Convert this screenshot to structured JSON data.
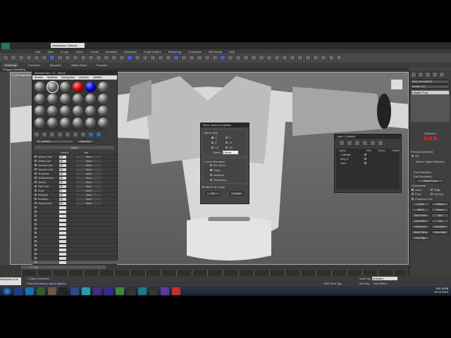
{
  "window": {
    "title": "Workspace: Default"
  },
  "menu": [
    "Edit",
    "Tools",
    "Group",
    "Views",
    "Create",
    "Modifiers",
    "Animation",
    "Graph Editors",
    "Rendering",
    "Customize",
    "MAXScript",
    "Help"
  ],
  "ribbon": {
    "tabs": [
      "Modeling",
      "Freeform",
      "Selection",
      "Object Paint",
      "Populate"
    ],
    "panel": "Polygon Modeling"
  },
  "viewport": {
    "label": "[+] [Perspective] [Shaded]"
  },
  "material_editor": {
    "title": "Material Editor - 01 - Default",
    "menu": [
      "Modes",
      "Material",
      "Navigation",
      "Options",
      "Utilities"
    ],
    "material_name": "01 - Default",
    "material_type": "Standard",
    "maps_title": "Maps",
    "headers": [
      "Amount",
      "Map"
    ],
    "rows": [
      {
        "name": "Ambient Color",
        "amount": "100",
        "map": "None"
      },
      {
        "name": "Diffuse Color",
        "amount": "100",
        "map": "None"
      },
      {
        "name": "Specular Color",
        "amount": "100",
        "map": "None"
      },
      {
        "name": "Specular Level",
        "amount": "100",
        "map": "None"
      },
      {
        "name": "Glossiness",
        "amount": "100",
        "map": "None"
      },
      {
        "name": "Self-Illumination",
        "amount": "100",
        "map": "None"
      },
      {
        "name": "Opacity",
        "amount": "100",
        "map": "None"
      },
      {
        "name": "Filter Color",
        "amount": "100",
        "map": "None"
      },
      {
        "name": "Bump",
        "amount": "30",
        "map": "None"
      },
      {
        "name": "Reflection",
        "amount": "100",
        "map": "None"
      },
      {
        "name": "Refraction",
        "amount": "100",
        "map": "None"
      },
      {
        "name": "Displacement",
        "amount": "100",
        "map": "None"
      }
    ]
  },
  "mirror_dialog": {
    "title": "Mirror: World Coordinates",
    "axis_title": "Mirror Axis:",
    "axes": [
      "X",
      "Y",
      "Z",
      "XY",
      "YZ",
      "ZX"
    ],
    "offset_label": "Offset:",
    "offset_value": "0.0mm",
    "clone_title": "Clone Selection:",
    "clone_options": [
      "No Clone",
      "Copy",
      "Instance",
      "Reference"
    ],
    "selected_clone": "Copy",
    "ik_label": "Mirror IK Limits",
    "ok": "OK",
    "cancel": "Cancel"
  },
  "layer_manager": {
    "title": "Layer: 0 (default)",
    "headers": [
      "Layers",
      "Hide",
      "Freeze",
      "Render"
    ],
    "layers": [
      "0 (default)",
      "Body_R",
      "Other"
    ]
  },
  "command_panel": {
    "object_name": "Artist_Shoulders01",
    "modifier_list": "Modifier List",
    "stack_item": "Editable Poly",
    "selection_title": "Selection",
    "preview": "Preview Selection",
    "off": "Off",
    "whole_object": "Whole Object Selected",
    "soft_selection": "Soft Selection",
    "edit_geometry": "Edit Geometry",
    "repeat_last": "Repeat Last",
    "constraints": "Constraints",
    "constraint_opts": [
      "None",
      "Edge",
      "Face",
      "Normal"
    ],
    "preserve_uvs": "Preserve UVs",
    "create": "Create",
    "collapse": "Collapse",
    "attach": "Attach",
    "detach": "Detach",
    "slice_plane": "Slice Plane",
    "split": "Split",
    "quickslice": "QuickSlice",
    "cut": "Cut",
    "msmooth": "MSmooth",
    "tessellate": "Tessellate",
    "make_planar": "Make Planar",
    "view_align": "View Align",
    "grid_align": "Grid Align"
  },
  "timeline": {
    "frame": "0 / 100"
  },
  "status": {
    "selected": "1 Object Selected",
    "prompt": "Click and drag to select objects",
    "autokey": "Auto Key",
    "selected_mode": "Selected",
    "setkey": "Set Key",
    "key_filters": "Key Filters...",
    "add_time_tag": "Add Time Tag",
    "welcome": "Welcome to M"
  },
  "taskbar": {
    "time": "15:38",
    "date": "15.12.2013",
    "lang": "EN",
    "icon_colors": [
      "#1e3a8a",
      "#1a6fb0",
      "#2f5f2f",
      "#6a5a3a",
      "#222",
      "#2a4a8a",
      "#2a9ab0",
      "#4a2a80",
      "#3a2a90",
      "#3a8a3a",
      "#333",
      "#1a7a8a",
      "#333",
      "#5a3aa0",
      "#c03030"
    ]
  }
}
